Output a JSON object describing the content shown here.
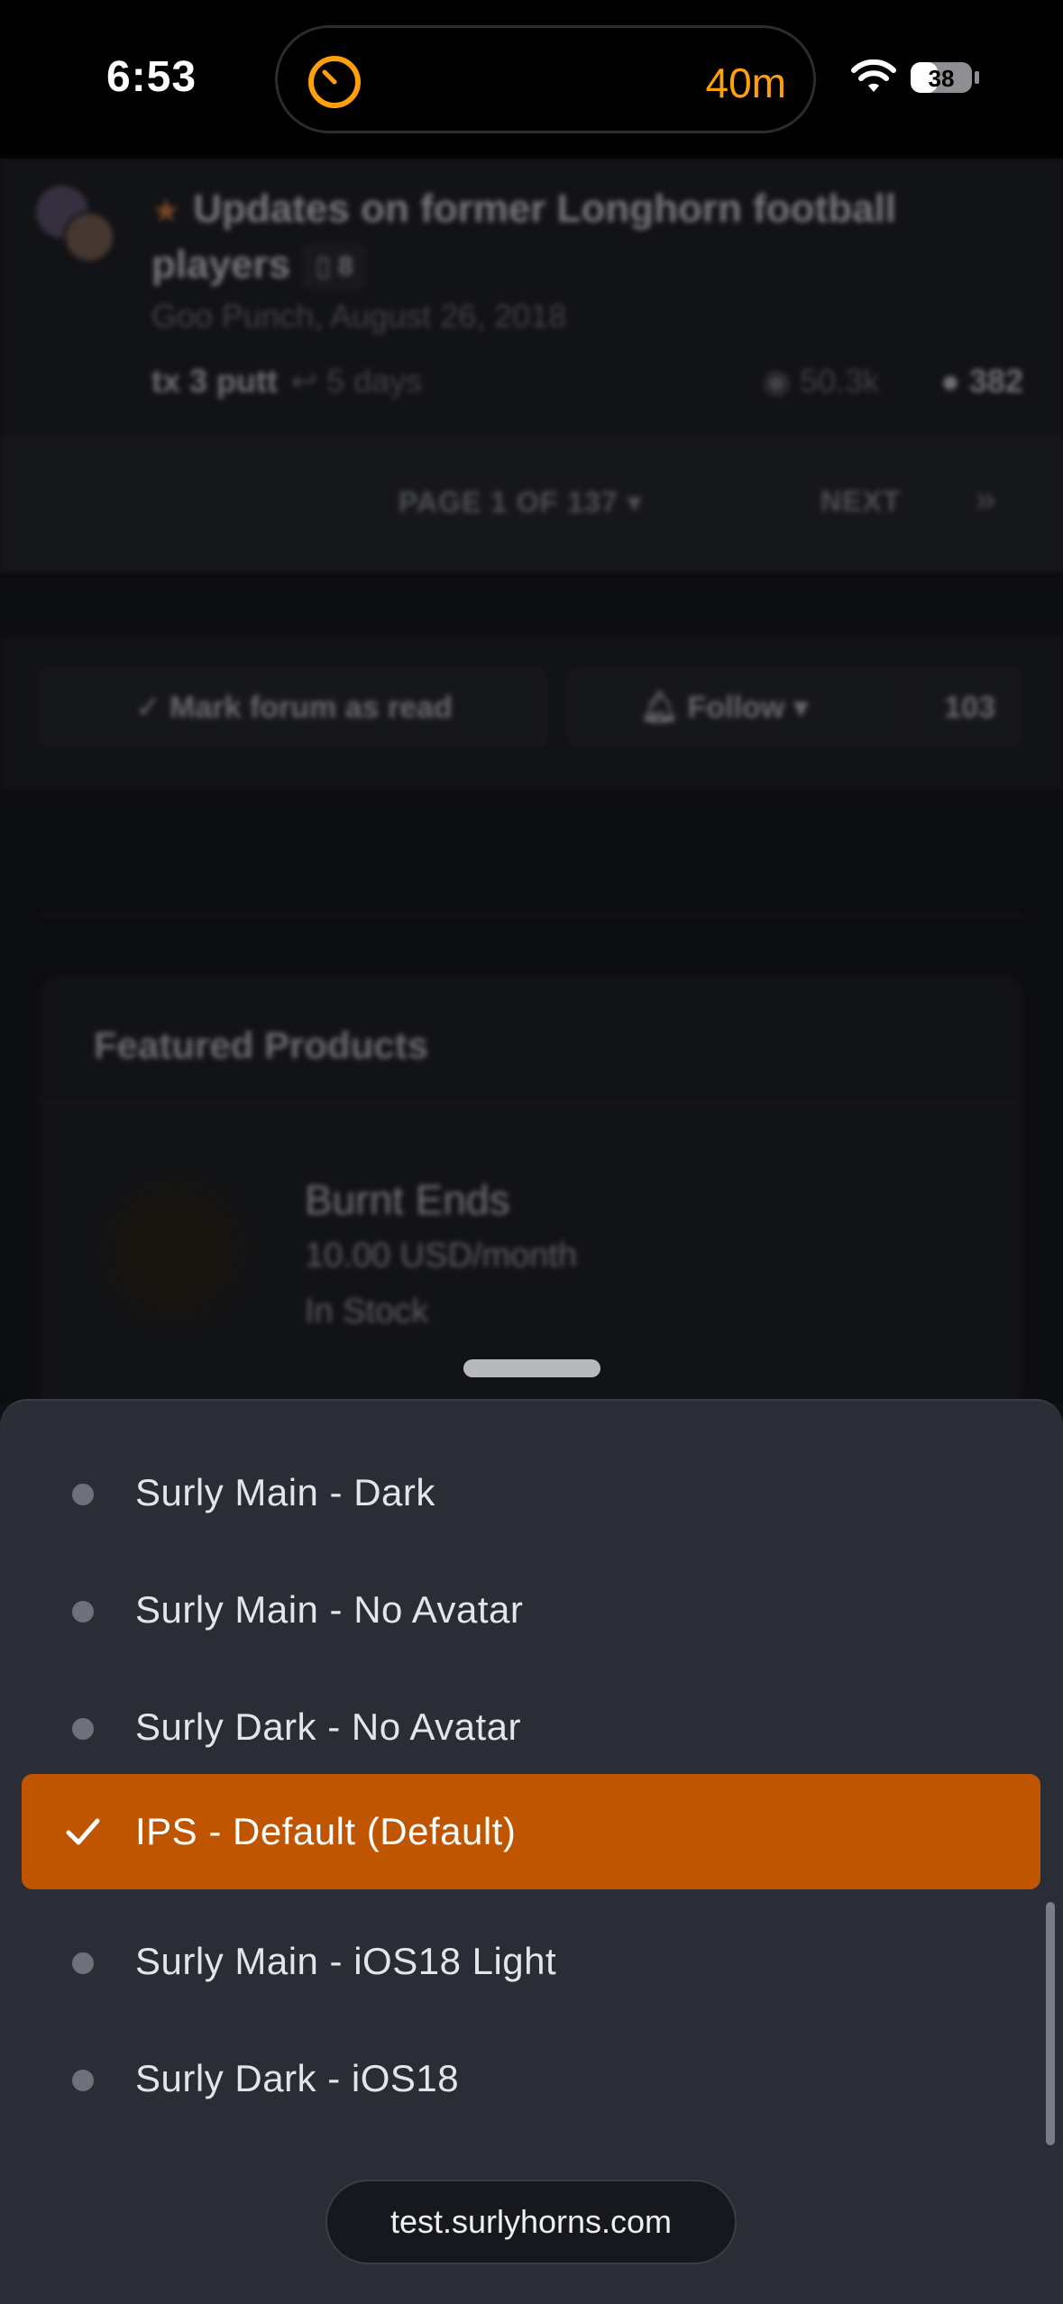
{
  "status_bar": {
    "time": "6:53",
    "timer": "40m",
    "battery": "38",
    "accent_color": "#ff9f0a"
  },
  "background": {
    "topic": {
      "title": "Updates on former Longhorn football players",
      "attachment_count": "8",
      "author_date": "Goo Punch, August 26, 2018",
      "last_poster": "tx 3 putt",
      "last_reply_ago": "5 days",
      "views": "50.3k",
      "replies": "382",
      "icons": [
        "star-icon",
        "attachment-icon",
        "reply-icon",
        "eye-icon",
        "comment-icon"
      ]
    },
    "pager": {
      "page_label": "PAGE 1 OF 137",
      "next_label": "NEXT",
      "last_label": "»"
    },
    "actions": {
      "mark_read_label": "Mark forum as read",
      "follow_label": "Follow",
      "follow_count": "103"
    },
    "featured": {
      "title": "Featured Products",
      "product_name": "Burnt Ends",
      "product_price": "10.00 USD/month",
      "product_stock": "In Stock"
    }
  },
  "theme_sheet": {
    "options": [
      {
        "label": "Surly Main - Dark",
        "selected": false
      },
      {
        "label": "Surly Main - No Avatar",
        "selected": false
      },
      {
        "label": "Surly Dark - No Avatar",
        "selected": false
      },
      {
        "label": "IPS - Default (Default)",
        "selected": true
      },
      {
        "label": "Surly Main - iOS18 Light",
        "selected": false
      },
      {
        "label": "Surly Dark - iOS18",
        "selected": false
      }
    ],
    "selected_color": "#c05500",
    "sheet_color": "#2a2d35"
  },
  "browser": {
    "url": "test.surlyhorns.com"
  }
}
